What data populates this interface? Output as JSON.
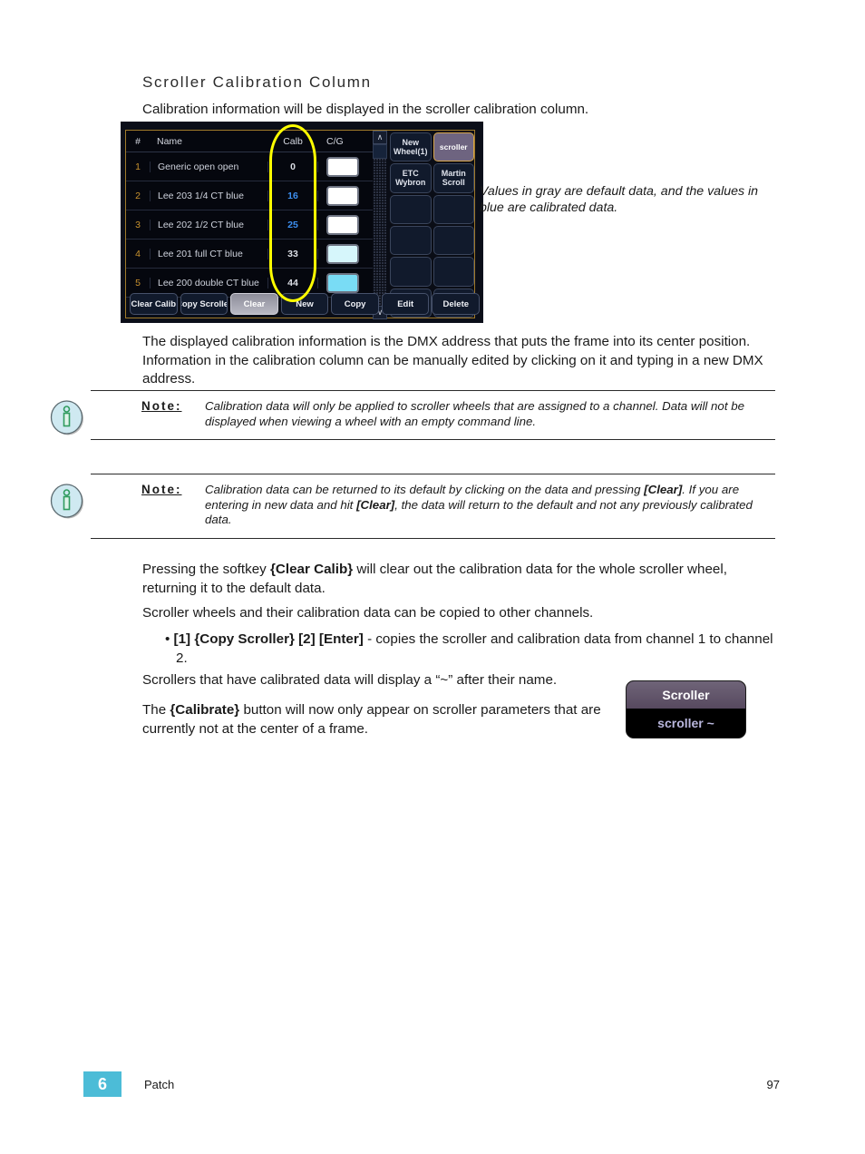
{
  "heading": "Scroller Calibration Column",
  "paragraphs": {
    "intro": "Calibration information will be displayed in the scroller calibration column.",
    "dmx": "The displayed calibration information is the DMX address that puts the frame into its center position. Information in the calibration column can be manually edited by clicking on it and typing in a new DMX address.",
    "tilde": "Scrollers that have calibrated data will display a “~” after their name."
  },
  "screenshot_caption": "Values in gray are default data, and the values in blue are calibrated data.",
  "scroller_ui": {
    "columns": {
      "num": "#",
      "name": "Name",
      "calb": "Calb",
      "cg": "C/G"
    },
    "rows": [
      {
        "num": "1",
        "name": "Generic open open",
        "calb": "0",
        "calibrated": false,
        "swatch": "#ffffff"
      },
      {
        "num": "2",
        "name": "Lee 203 1/4 CT blue",
        "calb": "16",
        "calibrated": true,
        "swatch": "#ffffff"
      },
      {
        "num": "3",
        "name": "Lee 202 1/2 CT blue",
        "calb": "25",
        "calibrated": true,
        "swatch": "#ffffff"
      },
      {
        "num": "4",
        "name": "Lee 201 full CT blue",
        "calb": "33",
        "calibrated": false,
        "swatch": "#d6f6fb"
      },
      {
        "num": "5",
        "name": "Lee 200 double CT blue",
        "calb": "44",
        "calibrated": false,
        "swatch": "#79dcf5"
      }
    ],
    "wheel_buttons": [
      {
        "label": "New Wheel(1)",
        "selected": false,
        "empty": false
      },
      {
        "label": "scroller",
        "selected": true,
        "empty": false
      },
      {
        "label": "ETC Wybron",
        "selected": false,
        "empty": false
      },
      {
        "label": "Martin Scroll",
        "selected": false,
        "empty": false
      },
      {
        "label": "",
        "selected": false,
        "empty": true
      },
      {
        "label": "",
        "selected": false,
        "empty": true
      },
      {
        "label": "",
        "selected": false,
        "empty": true
      },
      {
        "label": "",
        "selected": false,
        "empty": true
      },
      {
        "label": "",
        "selected": false,
        "empty": true
      },
      {
        "label": "",
        "selected": false,
        "empty": true
      },
      {
        "label": "",
        "selected": false,
        "empty": true
      },
      {
        "label": "",
        "selected": false,
        "empty": true
      }
    ],
    "softkeys": [
      {
        "label": "Clear Calib",
        "active": false
      },
      {
        "label": "Copy Scroller",
        "active": false
      },
      {
        "label": "Clear",
        "active": true
      },
      {
        "label": "New",
        "active": false
      },
      {
        "label": "Copy",
        "active": false
      },
      {
        "label": "Edit",
        "active": false
      },
      {
        "label": "Delete",
        "active": false
      }
    ],
    "scrollbar": {
      "up": "∧",
      "down": "∨"
    },
    "highlight_color": "#ffff00"
  },
  "notes": [
    {
      "label": "Note:",
      "text": "Calibration data will only be applied to scroller wheels that are assigned to a channel. Data will not be displayed when viewing a wheel with an empty command line."
    },
    {
      "label": "Note:",
      "text_parts": [
        "Calibration data can be returned to its default by clicking on the data and pressing ",
        "[Clear]",
        ". If you are entering in new data and hit ",
        "[Clear]",
        ", the data will return to the default and not any previously calibrated data."
      ]
    }
  ],
  "press_softkey": {
    "prefix": "Pressing the softkey ",
    "key": "{Clear Calib}",
    "suffix": " will clear out the calibration data for the whole scroller wheel, returning it to the default data."
  },
  "wheels_copy": "Scroller wheels and their calibration data can be copied to other channels.",
  "bullet": {
    "marker": "•",
    "bold": "[1] {Copy Scroller} [2] [Enter]",
    "rest": " - copies the scroller and calibration data from channel 1 to channel 2."
  },
  "calibrate_para": {
    "prefix": "The ",
    "key": "{Calibrate}",
    "suffix": " button will now only appear on scroller parameters that are currently not at the center of a frame."
  },
  "scroller_display": {
    "title": "Scroller",
    "value": "scroller ~"
  },
  "footer": {
    "chapter_number": "6",
    "chapter_name": "Patch",
    "page_number": "97"
  },
  "colors": {
    "accent": "#4cbcd7",
    "calibrated_blue": "#3d8ff0",
    "highlight_yellow": "#ffff00"
  }
}
